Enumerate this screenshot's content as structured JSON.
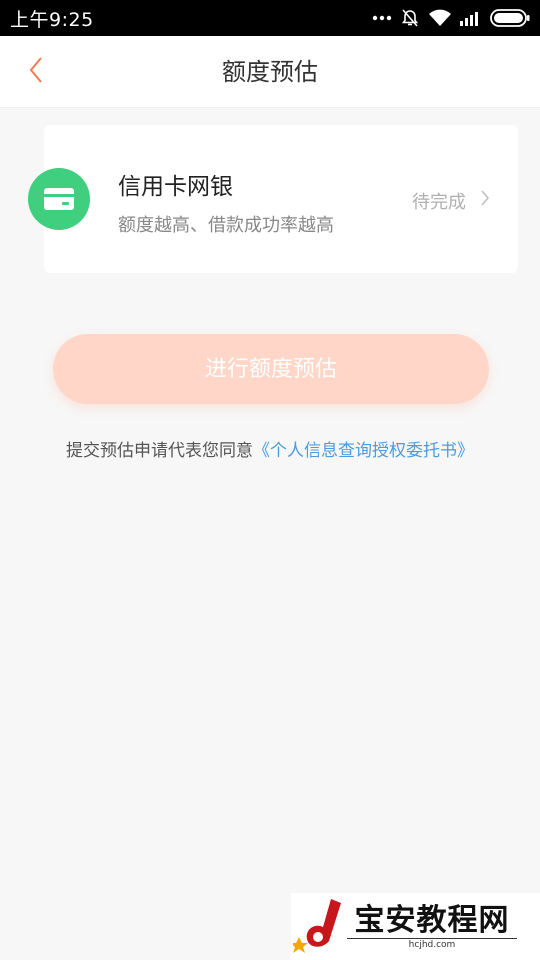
{
  "status_bar": {
    "time": "上午9:25",
    "icons": [
      "more-dots-icon",
      "alarm-off-icon",
      "wifi-icon",
      "signal-icon",
      "battery-icon"
    ]
  },
  "nav": {
    "title": "额度预估",
    "back_icon": "chevron-left-icon"
  },
  "card": {
    "icon": "credit-card-icon",
    "title": "信用卡网银",
    "subtitle": "额度越高、借款成功率越高",
    "status": "待完成",
    "arrow_icon": "chevron-right-icon"
  },
  "primary_button": {
    "label": "进行额度预估"
  },
  "agreement": {
    "prefix": "提交预估申请代表您同意",
    "link": "《个人信息查询授权委托书》"
  },
  "watermark": {
    "title": "宝安教程网",
    "url": "hcjhd.com"
  },
  "colors": {
    "accent_orange": "#f47b50",
    "button_disabled": "#ffd6c7",
    "icon_green": "#3fcf7e",
    "link_blue": "#4a9be0"
  }
}
